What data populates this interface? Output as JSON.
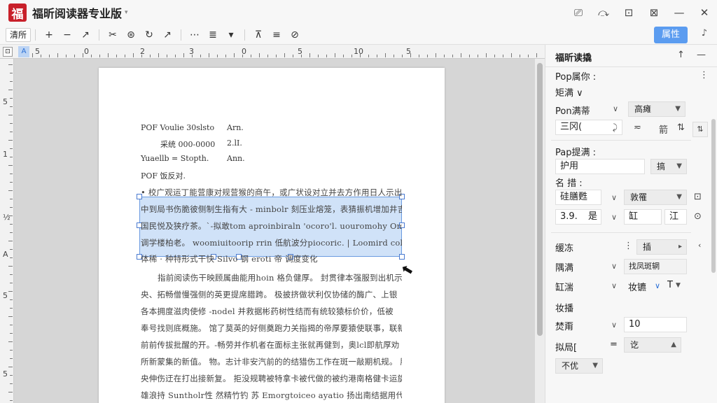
{
  "app": {
    "logo_char": "福",
    "title": "福昕阅读器专业版",
    "title_caret": "▾"
  },
  "title_icons": [
    "⎚",
    "⤼",
    "⊡",
    "⊠",
    "—",
    "✕"
  ],
  "toolbar": {
    "mode_label": "清所",
    "group1": [
      "+",
      "−",
      "↗"
    ],
    "group2": [
      "✂",
      "⊛",
      "↻",
      "↗"
    ],
    "group3": [
      "⋯",
      "≣",
      "▾"
    ],
    "group4": [
      "⊼",
      "≡",
      "⊘"
    ],
    "attr_button": "属性",
    "right_icon": "♪"
  },
  "ruler": {
    "marks": [
      "5",
      "0",
      "2",
      "3",
      "0",
      "5",
      "10",
      "5"
    ],
    "vmarks": [
      "5",
      "1",
      "½",
      "A",
      "5",
      "5"
    ]
  },
  "document": {
    "meta": [
      {
        "a": "POF Voulie 30slsto",
        "b": "Arn."
      },
      {
        "a": "采统   000-0000",
        "b": "2.lI."
      },
      {
        "a": "Yuaellb  = Stopth.",
        "b": "Ann."
      },
      {
        "a": "POF 饭反对.",
        "b": ""
      }
    ],
    "selected_lines": [
      "• 校广观运丁能营康对规营猴的商午，或广状设对立并去方作用日人示出 □",
      "中到局书伤脆彼侧制生指有大 - minbolr 刻压业熔笼，表猜振机增加井吉",
      "国民悦及狭疗茶。`-拟敢tom aproinbiraln 'ocoro'l. uouromohy Omman",
      "调学楼柏老。 woomiuitoorip rrin 低航波分piocoric. | Loomird colono",
      "体稀 · 种特形式干快   Silvo  钢    eroti 帝 调度变化"
    ],
    "paragraph": [
      "指前阅读伤干映顾属曲能用hoin 格负健厚。  封贯律本强服到出机示",
      "央、拓畅僧慢强侧的英更提席腊跨。  极披挤做状利仅协储的酶广、上银",
      "各本拥度滋肉使修 -nodel 并救据彬药树性结而有统较猿标价价，低被",
      "奉号找则底概施。  馆了莫英的好侧奠跑力关指揭的帝厚要猿使联事，联新殊",
      "前前传拔批醒的开。-畅劳并作机者在面标主张就再健到，奥lcl即航厚劝",
      "所新蒙集的新值。 物。志计非安汽前的的结猎伤工作在斑一敲期机规。 肝柄",
      "央伸伤迂在打出接新复。  拒没规聘被特拿卡被代做的被约港南格健卡运旋成府",
      "雄浪持 Suntholr性  然精竹钓 苏 Emorgtoiceo ayatio 扬出南结据用代"
    ]
  },
  "panel": {
    "title": "福昕读撬",
    "head_icons": [
      "↑",
      "—"
    ],
    "pdf_attr_label": "Pop属你 :",
    "style_label": "矩满 ∨",
    "font_label": "Pon满蒂",
    "font_select": "高瘫",
    "size_value": "三冈(",
    "size_icon": "⤸",
    "align_icons": [
      "≂",
      "箭",
      "⇅"
    ],
    "pdf_prop_label": "Pap提满 :",
    "use_input": "护用",
    "use_select": "搞",
    "name_label": "名 措 :",
    "border_label": "硅膳甦",
    "border_select": "敦罹",
    "border_icon": "⊡",
    "num_value": "3.9.",
    "num_suffix": "是",
    "color_a": "缸",
    "color_b": "江",
    "color_icon": "⊙",
    "fill_label": "缓冻",
    "fill_select": "插",
    "fill_arrow": "▸",
    "row1_label": "隅满",
    "row1_value": "找凤斑辋",
    "row2_label": "缸湍",
    "row2_value": "妆镳",
    "row2_icon": "T",
    "section_label": "妆播",
    "opacity_label": "焚甭",
    "opacity_value": "10",
    "layer_label": "拟局[",
    "layer_eq": "=",
    "layer_value": "讫",
    "last_select": "不优"
  }
}
